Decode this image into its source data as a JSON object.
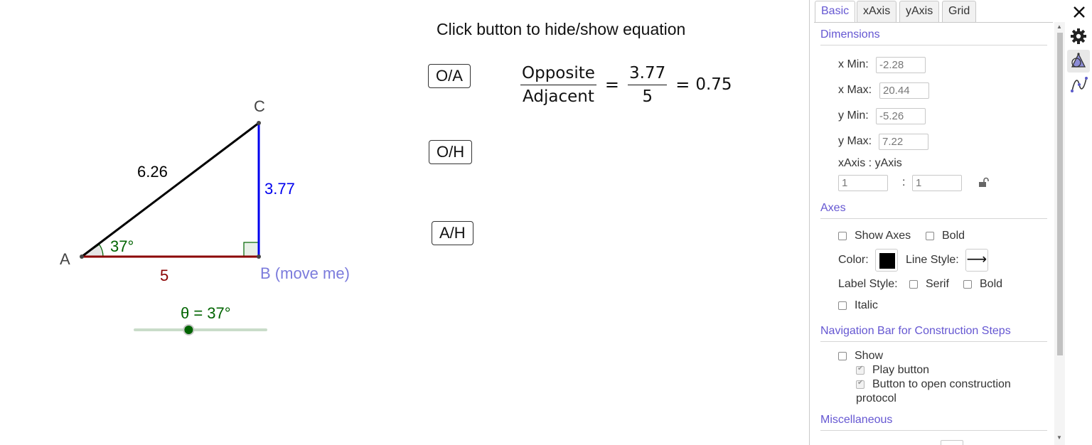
{
  "graphics": {
    "instruction": "Click button to hide/show equation",
    "buttons": [
      {
        "label": "O/A"
      },
      {
        "label": "O/H"
      },
      {
        "label": "A/H"
      }
    ],
    "equation": {
      "num_word": "Opposite",
      "den_word": "Adjacent",
      "num_value": "3.77",
      "den_value": "5",
      "result": "0.75"
    },
    "points": {
      "A": "A",
      "B": "B (move me)",
      "C": "C"
    },
    "lengths": {
      "hyp": "6.26",
      "opp": "3.77",
      "adj": "5"
    },
    "angle_label": "37°",
    "slider_label": "θ = 37°",
    "slider_value_fraction": 0.41,
    "colors": {
      "hyp": "#000000",
      "opp": "#0000ee",
      "adj": "#8b0000",
      "angle": "#006400",
      "point_b_label": "#7b7bdc"
    }
  },
  "panel": {
    "tabs": [
      "Basic",
      "xAxis",
      "yAxis",
      "Grid"
    ],
    "active_tab": "Basic",
    "dimensions": {
      "title": "Dimensions",
      "xmin_label": "x Min:",
      "xmin": "-2.28",
      "xmax_label": "x Max:",
      "xmax": "20.44",
      "ymin_label": "y Min:",
      "ymin": "-5.26",
      "ymax_label": "y Max:",
      "ymax": "7.22",
      "ratio_label": "xAxis : yAxis",
      "ratio_x": "1",
      "ratio_sep": ":",
      "ratio_y": "1"
    },
    "axes": {
      "title": "Axes",
      "show_axes": "Show Axes",
      "bold": "Bold",
      "color_label": "Color:",
      "line_style_label": "Line Style:",
      "line_style_glyph": "⟶",
      "label_style_label": "Label Style:",
      "serif": "Serif",
      "bold2": "Bold",
      "italic": "Italic"
    },
    "navbar": {
      "title": "Navigation Bar for Construction Steps",
      "show": "Show",
      "play_button": "Play button",
      "open_protocol_1": "Button to open construction",
      "open_protocol_2": "protocol"
    },
    "misc": {
      "title": "Miscellaneous"
    }
  }
}
